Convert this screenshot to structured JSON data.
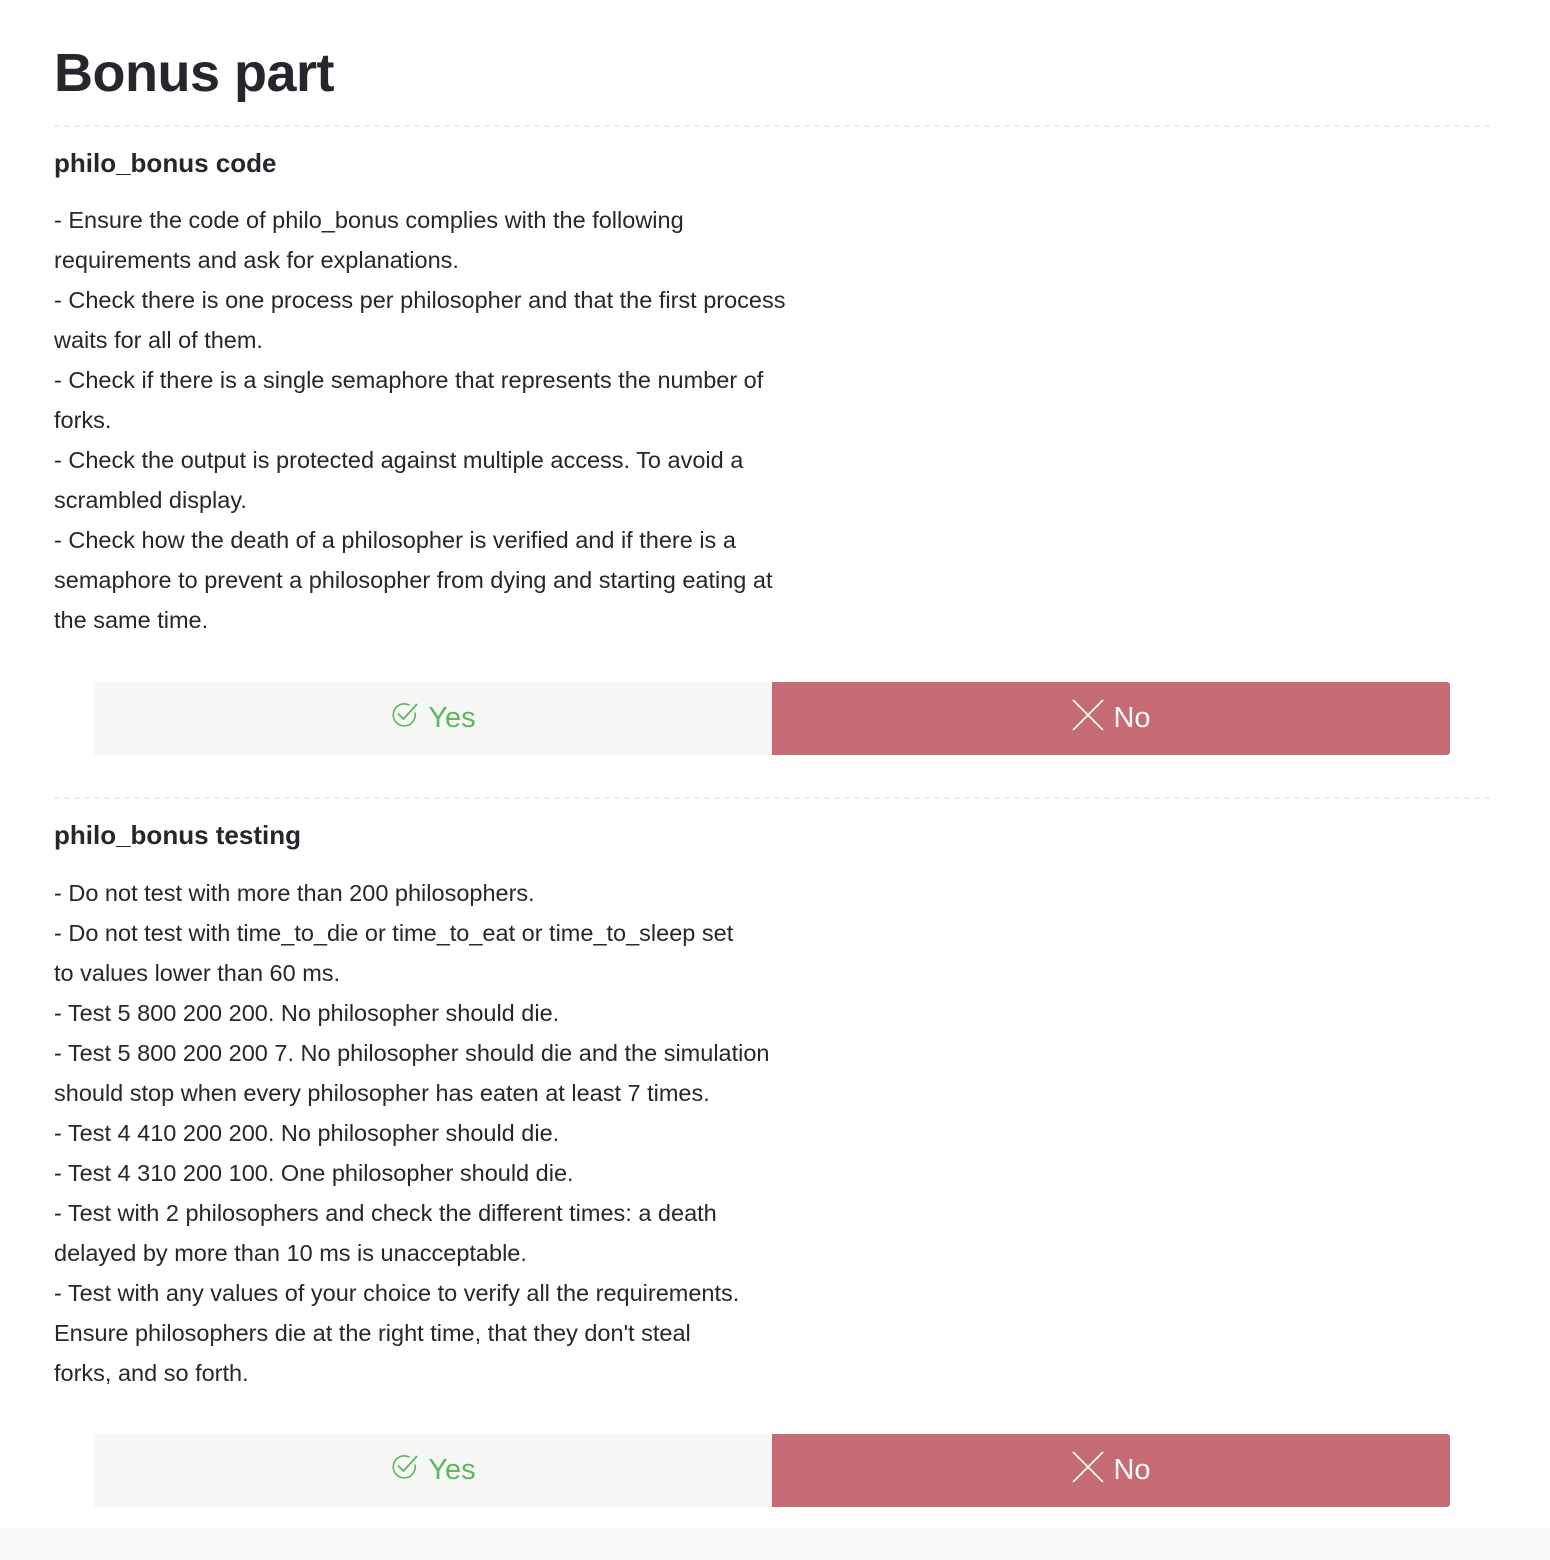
{
  "page": {
    "title": "Bonus part"
  },
  "sections": [
    {
      "title": "philo_bonus code",
      "lines": [
        "- Ensure the code of philo_bonus complies with the following",
        "requirements and ask for explanations.",
        "- Check there is one process per philosopher and that the first process",
        "waits for all of them.",
        "- Check if there is a single semaphore that represents the number of",
        "forks.",
        "- Check the output is protected against multiple access. To avoid a",
        "scrambled display.",
        "- Check how the death of a philosopher is verified and if there is a",
        "semaphore to prevent a philosopher from dying and starting eating at",
        "the same time."
      ],
      "yes_label": "Yes",
      "no_label": "No"
    },
    {
      "title": "philo_bonus testing",
      "lines": [
        "- Do not test with more than 200 philosophers.",
        "- Do not test with time_to_die or time_to_eat or time_to_sleep set",
        "to values lower than 60 ms.",
        "- Test 5 800 200 200. No philosopher should die.",
        "- Test 5 800 200 200 7. No philosopher should die and the simulation",
        "should stop when every philosopher has eaten at least 7 times.",
        "- Test 4 410 200 200. No philosopher should die.",
        "- Test 4 310 200 100. One philosopher should die.",
        "- Test with 2 philosophers and check the different times: a death",
        "delayed by more than 10 ms is unacceptable.",
        "- Test with any values of your choice to verify all the requirements.",
        "Ensure philosophers die at the right time, that they don't steal",
        "forks, and so forth."
      ],
      "yes_label": "Yes",
      "no_label": "No"
    }
  ],
  "icons": {
    "yes": "check-circle-icon",
    "no": "cross-icon"
  },
  "colors": {
    "yes_text": "#5cb85c",
    "yes_bg": "#f7f8f6",
    "no_bg": "#c66a73",
    "no_text": "#ffffff",
    "heading_text": "#26262c"
  }
}
